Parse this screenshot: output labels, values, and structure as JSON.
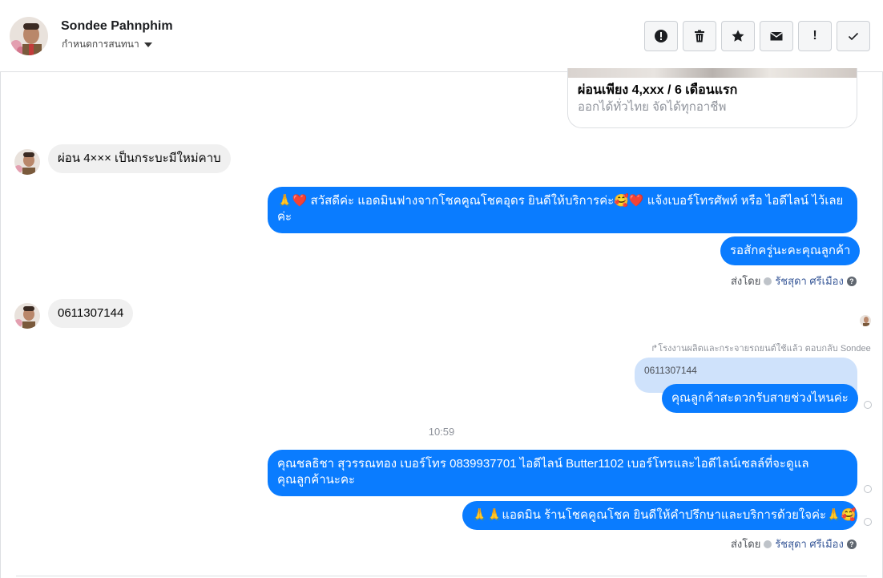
{
  "header": {
    "name": "Sondee Pahnphim",
    "subtitle": "กำหนดการสนทนา",
    "tools": [
      {
        "icon": "alert-circle-icon"
      },
      {
        "icon": "trash-icon"
      },
      {
        "icon": "star-icon"
      },
      {
        "icon": "envelope-icon"
      },
      {
        "icon": "exclamation-icon",
        "label": "!"
      },
      {
        "icon": "check-icon"
      }
    ]
  },
  "card": {
    "title": "ผ่อนเพียง 4,xxx / 6 เดือนแรก",
    "description": "ออกได้ทั่วไทย จัดได้ทุกอาชีพ"
  },
  "messages": {
    "in1": "ผ่อน  4××× เป็นกระบะมีใหม่คาบ",
    "out1_line1": "🙏❤️ สวัสดีค่ะ แอดมินฟางจากโชคคูณโชคอุดร ยินดีให้บริการค่ะ🥰❤️ แจ้งเบอร์โทรศัพท์ หรือ ไอดีไลน์  ไว้เลย",
    "out1_line2": "ค่ะ",
    "out2": "รอสักครู่นะคะคุณลูกค้า",
    "in2": "0611307144",
    "reply_meta": "↱โรงงานผลิตและกระจายรถยนต์ใช้แล้ว ตอบกลับ Sondee",
    "quoted": "0611307144",
    "out3": "คุณลูกค้าสะดวกรับสายช่วงไหนค่ะ",
    "time": "10:59",
    "out4_line1": "คุณชลธิชา สุวรรณทอง   เบอร์โทร 0839937701  ไอดีไลน์ Butter1102  เบอร์โทรและไอดีไลน์เซลล์ที่จะดูแล",
    "out4_line2": "คุณลูกค้านะคะ",
    "out5": "🙏🙏แอดมิน ร้านโชคคูณโชค ยินดีให้คำปรึกษาและบริการด้วยใจค่ะ🙏🥰"
  },
  "sent_by": {
    "prefix": "ส่งโดย",
    "agent": "รัชสุดา ศรีเมือง",
    "help": "?"
  }
}
